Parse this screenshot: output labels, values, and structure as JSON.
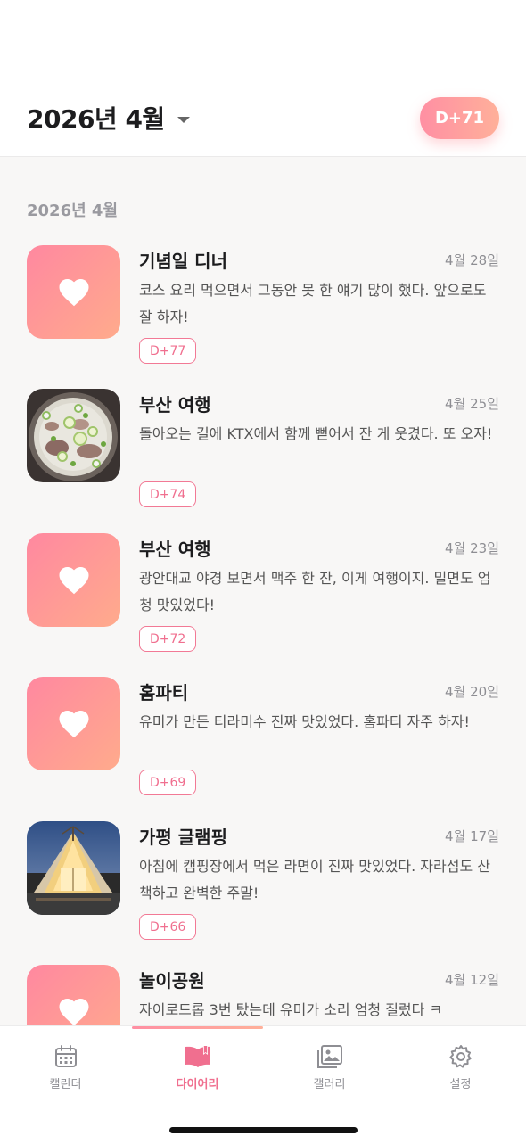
{
  "header": {
    "month_label": "2026년 4월",
    "dday_badge": "D+71"
  },
  "section": {
    "title": "2026년 4월"
  },
  "entries": [
    {
      "title": "기념일 디너",
      "date": "4월 28일",
      "body": "코스 요리 먹으면서 그동안 못 한 얘기 많이 했다. 앞으로도 잘 하자!",
      "tag": "D+77",
      "thumb": "heart-icon"
    },
    {
      "title": "부산 여행",
      "date": "4월 25일",
      "body": "돌아오는 길에 KTX에서 함께 뻗어서 잔 게 웃겼다. 또 오자!",
      "tag": "D+74",
      "thumb": "soup-photo"
    },
    {
      "title": "부산 여행",
      "date": "4월 23일",
      "body": "광안대교 야경 보면서 맥주 한 잔, 이게 여행이지. 밀면도 엄청 맛있었다!",
      "tag": "D+72",
      "thumb": "heart-icon"
    },
    {
      "title": "홈파티",
      "date": "4월 20일",
      "body": "유미가 만든 티라미수 진짜 맛있었다. 홈파티 자주 하자!",
      "tag": "D+69",
      "thumb": "heart-icon"
    },
    {
      "title": "가평 글램핑",
      "date": "4월 17일",
      "body": "아침에 캠핑장에서 먹은 라면이 진짜 맛있었다. 자라섬도 산책하고 완벽한 주말!",
      "tag": "D+66",
      "thumb": "glamping-photo"
    },
    {
      "title": "놀이공원",
      "date": "4월 12일",
      "body": "자이로드롭 3번 탔는데 유미가 소리 엄청 질렀다 ㅋ",
      "tag": "",
      "thumb": "heart-icon"
    }
  ],
  "tabs": [
    {
      "label": "캘린더",
      "icon": "calendar-icon"
    },
    {
      "label": "다이어리",
      "icon": "book-icon",
      "active": true
    },
    {
      "label": "갤러리",
      "icon": "gallery-icon"
    },
    {
      "label": "설정",
      "icon": "gear-icon"
    }
  ],
  "colors": {
    "accent": "#f06f8f",
    "gradient_start": "#ff8fa3",
    "gradient_end": "#ffb09a"
  }
}
